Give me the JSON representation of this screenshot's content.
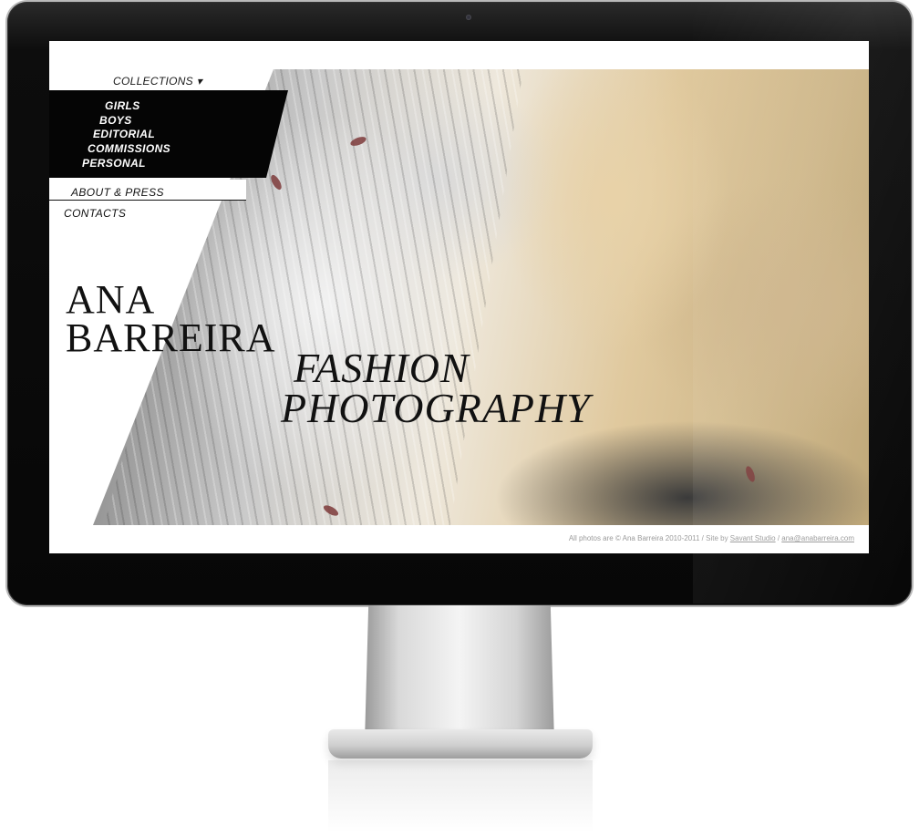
{
  "site": {
    "nav": {
      "collections_label": "COLLECTIONS ▾",
      "collections_items": [
        "GIRLS",
        "BOYS",
        "EDITORIAL",
        "COMMISSIONS",
        "PERSONAL"
      ],
      "about_label": "ABOUT & PRESS",
      "contacts_label": "CONTACTS"
    },
    "hero": {
      "name_line1": "ANA",
      "name_line2": "BARREIRA",
      "subtitle_line1": "FASHION",
      "subtitle_line2": "PHOTOGRAPHY"
    },
    "footer": {
      "text": "All photos are © Ana Barreira 2010-2011 / Site by ",
      "studio_link": "Savant Studio",
      "separator": " / ",
      "email_link": "ana@anabarreira.com"
    }
  },
  "colors": {
    "nav_black": "#050505",
    "text_dark": "#111111",
    "footer_gray": "#9a9a9a"
  },
  "icons": {
    "camera": "webcam-icon"
  }
}
